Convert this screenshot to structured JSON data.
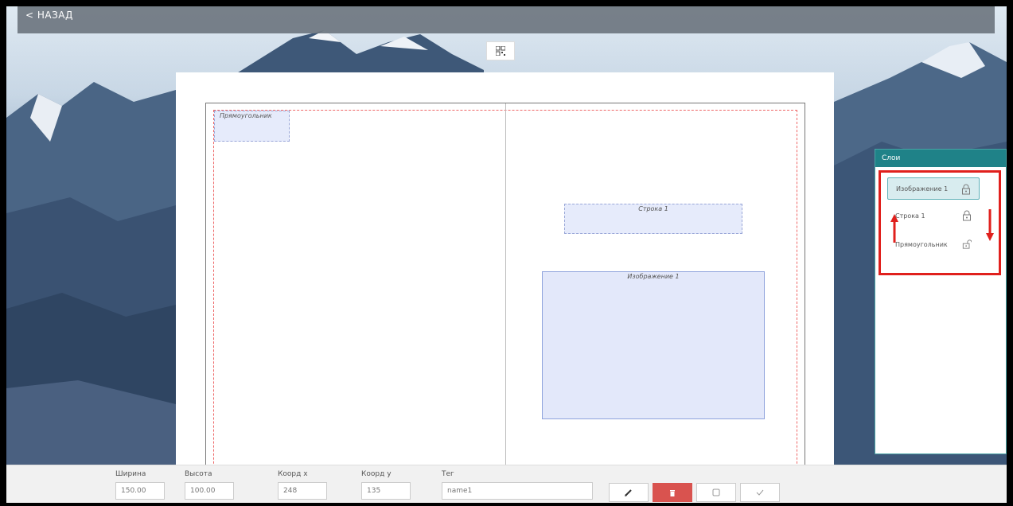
{
  "header": {
    "back_label": "< НАЗАД"
  },
  "canvas": {
    "objects": {
      "rectangle": "Прямоугольник",
      "line": "Строка 1",
      "image": "Изображение 1"
    }
  },
  "layers": {
    "title": "Слои",
    "items": [
      {
        "label": "Изображение 1",
        "selected": true,
        "locked": true
      },
      {
        "label": "Строка 1",
        "selected": false,
        "locked": true
      },
      {
        "label": "Прямоугольник",
        "selected": false,
        "locked": false
      }
    ]
  },
  "properties": {
    "width_label": "Ширина",
    "width_value": "150.00",
    "height_label": "Высота",
    "height_value": "100.00",
    "x_label": "Коорд х",
    "x_value": "248",
    "y_label": "Коорд у",
    "y_value": "135",
    "tag_label": "Тег",
    "tag_value": "name1"
  },
  "icons": {
    "qr": "qr-code-icon",
    "edit": "pencil-icon",
    "delete": "trash-icon",
    "duplicate": "duplicate-icon",
    "confirm": "check-icon",
    "lock": "lock-icon",
    "unlock": "unlock-icon"
  },
  "colors": {
    "accent": "#1f8288",
    "danger": "#d9534f",
    "highlight": "#e0201d"
  }
}
